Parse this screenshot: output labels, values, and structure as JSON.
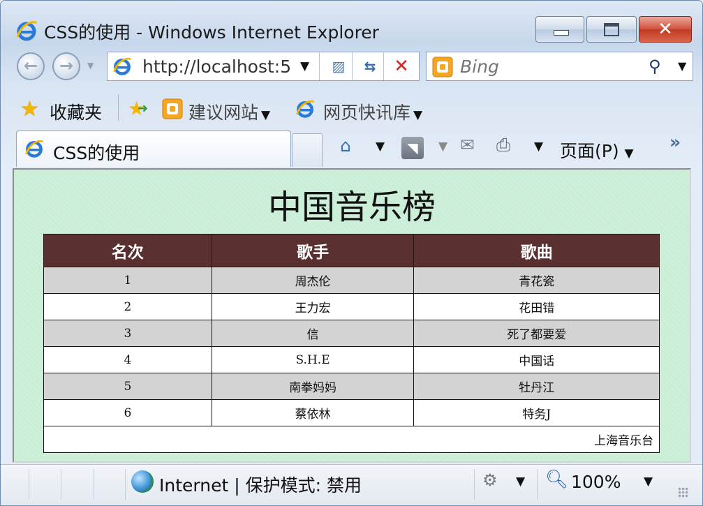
{
  "window": {
    "title": "CSS的使用 - Windows Internet Explorer"
  },
  "nav": {
    "address": "http://localhost:5",
    "search_placeholder": "Bing"
  },
  "favorites": {
    "label": "收藏夹",
    "links": [
      "建议网站",
      "网页快讯库"
    ]
  },
  "tab": {
    "label": "CSS的使用"
  },
  "commandbar": {
    "page_menu": "页面(P)"
  },
  "page": {
    "title": "中国音乐榜",
    "table": {
      "headers": [
        "名次",
        "歌手",
        "歌曲"
      ],
      "rows": [
        [
          "1",
          "周杰伦",
          "青花瓷"
        ],
        [
          "2",
          "王力宏",
          "花田错"
        ],
        [
          "3",
          "信",
          "死了都要爱"
        ],
        [
          "4",
          "S.H.E",
          "中国话"
        ],
        [
          "5",
          "南拳妈妈",
          "牡丹江"
        ],
        [
          "6",
          "蔡依林",
          "特务J"
        ]
      ],
      "footer": "上海音乐台"
    }
  },
  "statusbar": {
    "zone": "Internet | 保护模式: 禁用",
    "zoom": "100%"
  },
  "colors": {
    "page_background": "#c9eed6",
    "header_background": "#5a2f2f",
    "odd_row": "#d3d3d3",
    "even_row": "#ffffff"
  }
}
